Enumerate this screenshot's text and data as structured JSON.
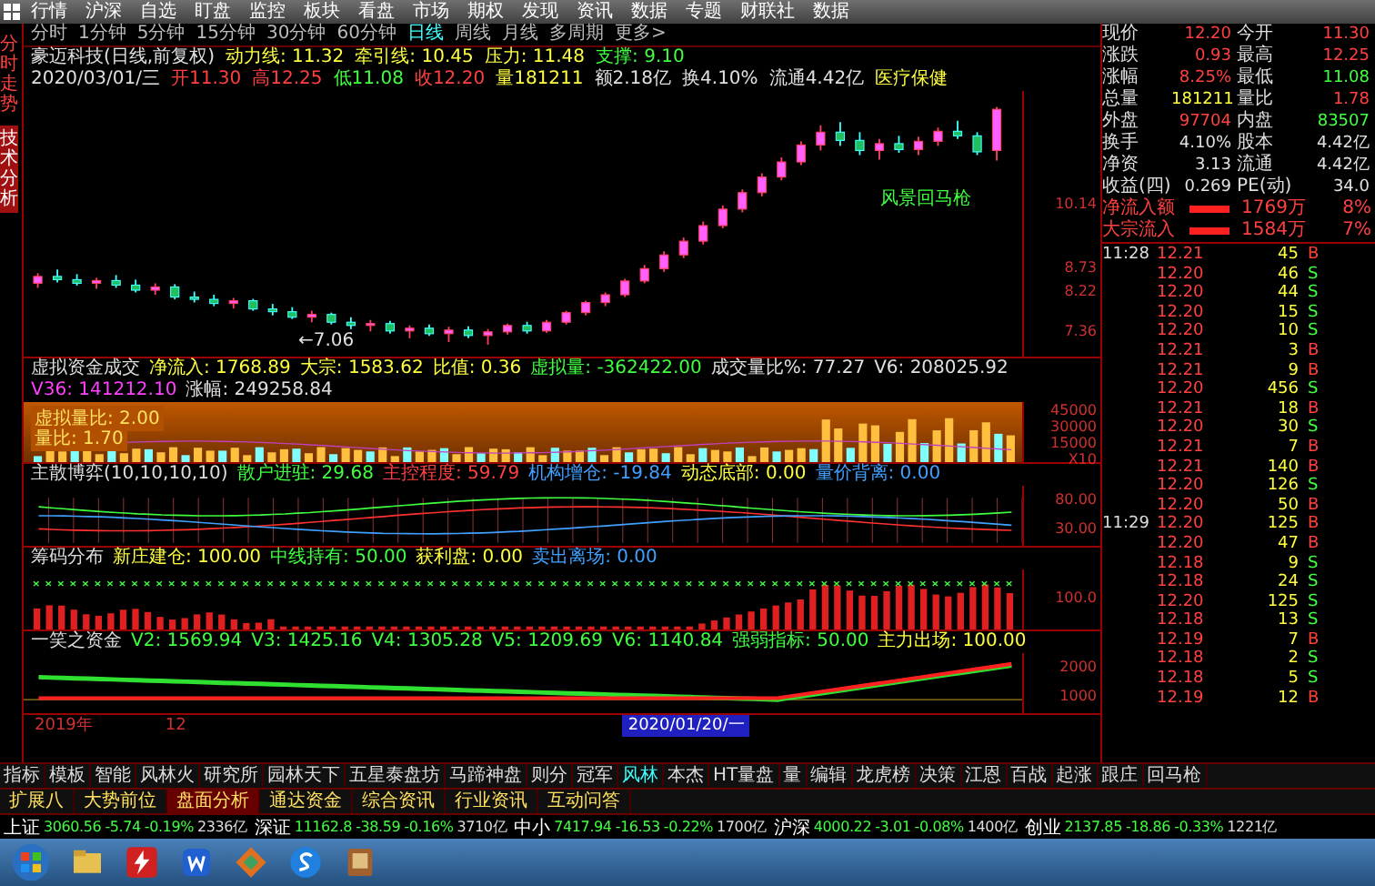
{
  "menu": [
    {
      "label": "行情",
      "selected": false
    },
    {
      "label": "沪深",
      "selected": false
    },
    {
      "label": "自选",
      "selected": false
    },
    {
      "label": "盯盘",
      "selected": false
    },
    {
      "label": "监控",
      "selected": false
    },
    {
      "label": "板块",
      "selected": false
    },
    {
      "label": "看盘",
      "selected": false
    },
    {
      "label": "市场",
      "selected": false
    },
    {
      "label": "期权",
      "selected": false
    },
    {
      "label": "发现",
      "selected": false
    },
    {
      "label": "资讯",
      "selected": false
    },
    {
      "label": "数据",
      "selected": false
    },
    {
      "label": "专题",
      "selected": false
    },
    {
      "label": "财联社",
      "selected": false
    },
    {
      "label": "数据",
      "selected": false
    }
  ],
  "side_tabs": [
    {
      "label": "分时走势",
      "selected": false
    },
    {
      "label": "技术分析",
      "selected": true
    }
  ],
  "periods": [
    {
      "label": "分时",
      "selected": false
    },
    {
      "label": "1分钟",
      "selected": false
    },
    {
      "label": "5分钟",
      "selected": false
    },
    {
      "label": "15分钟",
      "selected": false
    },
    {
      "label": "30分钟",
      "selected": false
    },
    {
      "label": "60分钟",
      "selected": false
    },
    {
      "label": "日线",
      "selected": true
    },
    {
      "label": "周线",
      "selected": false
    },
    {
      "label": "月线",
      "selected": false
    },
    {
      "label": "多周期",
      "selected": false
    },
    {
      "label": "更多>",
      "selected": false
    }
  ],
  "info_lines": [
    [
      {
        "text": "豪迈科技(日线,前复权)",
        "color": "#e0e0e0"
      },
      {
        "text": "动力线: 11.32",
        "color": "#ffff40"
      },
      {
        "text": "牵引线: 10.45",
        "color": "#ffff40"
      },
      {
        "text": "压力: 11.48",
        "color": "#ffff40"
      },
      {
        "text": "支撑: 9.10",
        "color": "#40ff40"
      }
    ],
    [
      {
        "text": "2020/03/01/三",
        "color": "#e0e0e0"
      },
      {
        "text": "开11.30",
        "color": "#ff4040"
      },
      {
        "text": "高12.25",
        "color": "#ff4040"
      },
      {
        "text": "低11.08",
        "color": "#40ff40"
      },
      {
        "text": "收12.20",
        "color": "#ff4040"
      },
      {
        "text": "量181211",
        "color": "#ffff40"
      },
      {
        "text": "额2.18亿",
        "color": "#e0e0e0"
      },
      {
        "text": "换4.10%",
        "color": "#e0e0e0"
      },
      {
        "text": "流通4.42亿",
        "color": "#e0e0e0"
      },
      {
        "text": "医疗保健",
        "color": "#ffff40"
      }
    ]
  ],
  "chart_labels": [
    {
      "text": "←7.06",
      "color": "#e0e0e0"
    },
    {
      "text": "风景回马枪",
      "color": "#40ff40"
    }
  ],
  "chart": {
    "chart_data": {
      "type": "candlestick",
      "ylim": [
        6.8,
        12.6
      ],
      "yticks": [
        {
          "value": 7.36,
          "label": "7.36"
        },
        {
          "value": 8.22,
          "label": "8.22"
        },
        {
          "value": 8.73,
          "label": "8.73"
        },
        {
          "value": 10.14,
          "label": "10.14"
        }
      ],
      "ohlc": [
        [
          8.4,
          8.62,
          8.3,
          8.55
        ],
        [
          8.55,
          8.7,
          8.42,
          8.48
        ],
        [
          8.48,
          8.6,
          8.35,
          8.4
        ],
        [
          8.4,
          8.52,
          8.28,
          8.46
        ],
        [
          8.46,
          8.58,
          8.3,
          8.36
        ],
        [
          8.36,
          8.48,
          8.2,
          8.25
        ],
        [
          8.25,
          8.4,
          8.15,
          8.32
        ],
        [
          8.32,
          8.38,
          8.05,
          8.1
        ],
        [
          8.1,
          8.22,
          7.98,
          8.05
        ],
        [
          8.05,
          8.15,
          7.9,
          7.96
        ],
        [
          7.96,
          8.08,
          7.85,
          8.02
        ],
        [
          8.02,
          8.06,
          7.8,
          7.84
        ],
        [
          7.84,
          7.95,
          7.7,
          7.78
        ],
        [
          7.78,
          7.88,
          7.62,
          7.66
        ],
        [
          7.66,
          7.8,
          7.55,
          7.72
        ],
        [
          7.72,
          7.76,
          7.5,
          7.55
        ],
        [
          7.55,
          7.66,
          7.4,
          7.48
        ],
        [
          7.48,
          7.6,
          7.35,
          7.52
        ],
        [
          7.52,
          7.58,
          7.3,
          7.36
        ],
        [
          7.36,
          7.48,
          7.2,
          7.42
        ],
        [
          7.42,
          7.5,
          7.25,
          7.3
        ],
        [
          7.3,
          7.45,
          7.12,
          7.38
        ],
        [
          7.38,
          7.46,
          7.2,
          7.26
        ],
        [
          7.26,
          7.4,
          7.06,
          7.34
        ],
        [
          7.34,
          7.52,
          7.28,
          7.48
        ],
        [
          7.48,
          7.56,
          7.3,
          7.36
        ],
        [
          7.36,
          7.6,
          7.32,
          7.55
        ],
        [
          7.55,
          7.8,
          7.5,
          7.76
        ],
        [
          7.76,
          8.02,
          7.7,
          7.98
        ],
        [
          7.98,
          8.2,
          7.9,
          8.15
        ],
        [
          8.15,
          8.5,
          8.1,
          8.45
        ],
        [
          8.45,
          8.8,
          8.4,
          8.72
        ],
        [
          8.72,
          9.1,
          8.65,
          9.02
        ],
        [
          9.02,
          9.4,
          8.95,
          9.32
        ],
        [
          9.32,
          9.75,
          9.25,
          9.66
        ],
        [
          9.66,
          10.1,
          9.6,
          10.02
        ],
        [
          10.02,
          10.45,
          9.95,
          10.38
        ],
        [
          10.38,
          10.8,
          10.3,
          10.72
        ],
        [
          10.72,
          11.15,
          10.65,
          11.05
        ],
        [
          11.05,
          11.5,
          10.98,
          11.42
        ],
        [
          11.42,
          11.85,
          11.3,
          11.7
        ],
        [
          11.7,
          11.92,
          11.4,
          11.52
        ],
        [
          11.52,
          11.7,
          11.2,
          11.3
        ],
        [
          11.3,
          11.55,
          11.1,
          11.45
        ],
        [
          11.45,
          11.62,
          11.25,
          11.32
        ],
        [
          11.32,
          11.6,
          11.2,
          11.5
        ],
        [
          11.5,
          11.8,
          11.4,
          11.72
        ],
        [
          11.72,
          11.95,
          11.55,
          11.62
        ],
        [
          11.62,
          11.7,
          11.2,
          11.27
        ],
        [
          11.3,
          12.25,
          11.08,
          12.2
        ]
      ]
    }
  },
  "indicators": [
    {
      "kind": "volume",
      "title": "虚拟资金成交",
      "values": [
        {
          "text": "净流入: 1768.89",
          "color": "#ffff40"
        },
        {
          "text": "大宗: 1583.62",
          "color": "#ffff40"
        },
        {
          "text": "比值: 0.36",
          "color": "#ffff40"
        },
        {
          "text": "虚拟量: -362422.00",
          "color": "#40ff40"
        },
        {
          "text": "成交量比%: 77.27",
          "color": "#e0e0e0"
        },
        {
          "text": "V6: 208025.92",
          "color": "#e0e0e0"
        },
        {
          "text": "V36: 141212.10",
          "color": "#ff40ff"
        },
        {
          "text": "涨幅: 249258.84",
          "color": "#e0e0e0"
        }
      ],
      "overlay": [
        "虚拟量比: 2.00",
        "量比: 1.70"
      ],
      "axis": [
        "45000",
        "30000",
        "15000",
        "X10"
      ]
    },
    {
      "kind": "lines",
      "title": "主散博弈(10,10,10,10)",
      "values": [
        {
          "text": "散户进驻: 29.68",
          "color": "#40ff40"
        },
        {
          "text": "主控程度: 59.79",
          "color": "#ff4040"
        },
        {
          "text": "机构增仓: -19.84",
          "color": "#40a0ff"
        },
        {
          "text": "动态底部: 0.00",
          "color": "#ffff40"
        },
        {
          "text": "量价背离: 0.00",
          "color": "#40a0ff"
        }
      ],
      "axis": [
        "80.00",
        "30.00"
      ]
    },
    {
      "kind": "bars",
      "title": "筹码分布",
      "values": [
        {
          "text": "新庄建仓: 100.00",
          "color": "#ffff40"
        },
        {
          "text": "中线持有: 50.00",
          "color": "#40ff40"
        },
        {
          "text": "获利盘: 0.00",
          "color": "#ffff40"
        },
        {
          "text": "卖出离场: 0.00",
          "color": "#40a0ff"
        }
      ],
      "axis": [
        "100.0"
      ]
    },
    {
      "kind": "band",
      "title": "一笑之资金",
      "values": [
        {
          "text": "V2: 1569.94",
          "color": "#40ff40"
        },
        {
          "text": "V3: 1425.16",
          "color": "#40ff40"
        },
        {
          "text": "V4: 1305.28",
          "color": "#40ff40"
        },
        {
          "text": "V5: 1209.69",
          "color": "#40ff40"
        },
        {
          "text": "V6: 1140.84",
          "color": "#40ff40"
        },
        {
          "text": "强弱指标: 50.00",
          "color": "#40ff40"
        },
        {
          "text": "主力出场: 100.00",
          "color": "#ffff40"
        }
      ],
      "axis": [
        "2000",
        "1000"
      ]
    }
  ],
  "time_axis": [
    "2019年",
    "12",
    "2020/01/20/一"
  ],
  "quote": [
    {
      "label": "现价",
      "value": "12.20",
      "color": "#ff4040"
    },
    {
      "label": "今开",
      "value": "11.30",
      "color": "#ff4040"
    },
    {
      "label": "涨跌",
      "value": "0.93",
      "color": "#ff4040"
    },
    {
      "label": "最高",
      "value": "12.25",
      "color": "#ff4040"
    },
    {
      "label": "涨幅",
      "value": "8.25%",
      "color": "#ff4040"
    },
    {
      "label": "最低",
      "value": "11.08",
      "color": "#40ff40"
    },
    {
      "label": "总量",
      "value": "181211",
      "color": "#ffff40"
    },
    {
      "label": "量比",
      "value": "1.78",
      "color": "#ff4040"
    },
    {
      "label": "外盘",
      "value": "97704",
      "color": "#ff4040"
    },
    {
      "label": "内盘",
      "value": "83507",
      "color": "#40ff40"
    },
    {
      "label": "换手",
      "value": "4.10%",
      "color": "#e0e0e0"
    },
    {
      "label": "股本",
      "value": "4.42亿",
      "color": "#e0e0e0"
    },
    {
      "label": "净资",
      "value": "3.13",
      "color": "#e0e0e0"
    },
    {
      "label": "流通",
      "value": "4.42亿",
      "color": "#e0e0e0"
    },
    {
      "label": "收益(四)",
      "value": "0.269",
      "color": "#e0e0e0"
    },
    {
      "label": "PE(动)",
      "value": "34.0",
      "color": "#e0e0e0"
    }
  ],
  "flows": [
    {
      "label": "净流入额",
      "value": "1769万",
      "share": "8%"
    },
    {
      "label": "大宗流入",
      "value": "1584万",
      "share": "7%"
    }
  ],
  "ticks": [
    {
      "time": "11:28",
      "price": "12.21",
      "volume": "45",
      "side": "B",
      "color": "#ff4040"
    },
    {
      "price": "12.20",
      "volume": "46",
      "side": "S",
      "color": "#40ff40"
    },
    {
      "price": "12.20",
      "volume": "44",
      "side": "S",
      "color": "#40ff40"
    },
    {
      "price": "12.20",
      "volume": "15",
      "side": "S",
      "color": "#40ff40"
    },
    {
      "price": "12.20",
      "volume": "10",
      "side": "S",
      "color": "#40ff40"
    },
    {
      "price": "12.21",
      "volume": "3",
      "side": "B",
      "color": "#ff4040"
    },
    {
      "price": "12.21",
      "volume": "9",
      "side": "B",
      "color": "#ff4040"
    },
    {
      "price": "12.20",
      "volume": "456",
      "side": "S",
      "color": "#40ff40"
    },
    {
      "price": "12.21",
      "volume": "18",
      "side": "B",
      "color": "#ff4040"
    },
    {
      "price": "12.20",
      "volume": "30",
      "side": "S",
      "color": "#40ff40"
    },
    {
      "price": "12.21",
      "volume": "7",
      "side": "B",
      "color": "#ff4040"
    },
    {
      "price": "12.21",
      "volume": "140",
      "side": "B",
      "color": "#ff4040"
    },
    {
      "price": "12.20",
      "volume": "126",
      "side": "S",
      "color": "#40ff40"
    },
    {
      "price": "12.20",
      "volume": "50",
      "side": "B",
      "color": "#ff4040"
    },
    {
      "time": "11:29",
      "price": "12.20",
      "volume": "125",
      "side": "B",
      "color": "#ff4040"
    },
    {
      "price": "12.20",
      "volume": "47",
      "side": "B",
      "color": "#ff4040"
    },
    {
      "price": "12.18",
      "volume": "9",
      "side": "S",
      "color": "#40ff40"
    },
    {
      "price": "12.18",
      "volume": "24",
      "side": "S",
      "color": "#40ff40"
    },
    {
      "price": "12.20",
      "volume": "125",
      "side": "S",
      "color": "#40ff40"
    },
    {
      "price": "12.18",
      "volume": "13",
      "side": "S",
      "color": "#40ff40"
    },
    {
      "price": "12.19",
      "volume": "7",
      "side": "B",
      "color": "#ff4040"
    },
    {
      "price": "12.18",
      "volume": "2",
      "side": "S",
      "color": "#40ff40"
    },
    {
      "price": "12.18",
      "volume": "5",
      "side": "S",
      "color": "#40ff40"
    },
    {
      "price": "12.19",
      "volume": "12",
      "side": "B",
      "color": "#ff4040"
    }
  ],
  "tool_tabs": [
    {
      "label": "指标",
      "selected": false
    },
    {
      "label": "模板",
      "selected": false
    },
    {
      "label": "智能",
      "selected": false
    },
    {
      "label": "风林火",
      "selected": false
    },
    {
      "label": "研究所",
      "selected": false
    },
    {
      "label": "园林天下",
      "selected": false
    },
    {
      "label": "五星泰盘坊",
      "selected": false
    },
    {
      "label": "马蹄神盘",
      "selected": false
    },
    {
      "label": "则分",
      "selected": false
    },
    {
      "label": "冠军",
      "selected": false
    },
    {
      "label": "风林",
      "selected": true
    },
    {
      "label": "本杰",
      "selected": false
    },
    {
      "label": "HT量盘",
      "selected": false
    },
    {
      "label": "量",
      "selected": false
    },
    {
      "label": "编辑",
      "selected": false
    },
    {
      "label": "龙虎榜",
      "selected": false
    },
    {
      "label": "决策",
      "selected": false
    },
    {
      "label": "江恩",
      "selected": false
    },
    {
      "label": "百战",
      "selected": false
    },
    {
      "label": "起涨",
      "selected": false
    },
    {
      "label": "跟庄",
      "selected": false
    },
    {
      "label": "回马枪",
      "selected": false
    }
  ],
  "ext_tabs": [
    {
      "label": "扩展八",
      "selected": false
    },
    {
      "label": "大势前位",
      "selected": false
    },
    {
      "label": "盘面分析",
      "selected": true
    },
    {
      "label": "通达资金",
      "selected": false
    },
    {
      "label": "综合资讯",
      "selected": false
    },
    {
      "label": "行业资讯",
      "selected": false
    },
    {
      "label": "互动问答",
      "selected": false
    }
  ],
  "status_bar": [
    {
      "name": "上证",
      "value": "3060.56",
      "change": "-5.74",
      "pct": "-0.19%",
      "amount": "2336亿"
    },
    {
      "name": "深证",
      "value": "11162.8",
      "change": "-38.59",
      "pct": "-0.16%",
      "amount": "3710亿"
    },
    {
      "name": "中小",
      "value": "7417.94",
      "change": "-16.53",
      "pct": "-0.22%",
      "amount": "1700亿"
    },
    {
      "name": "沪深",
      "value": "4000.22",
      "change": "-3.01",
      "pct": "-0.08%",
      "amount": "1400亿"
    },
    {
      "name": "创业",
      "value": "2137.85",
      "change": "-18.86",
      "pct": "-0.33%",
      "amount": "1221亿"
    }
  ]
}
